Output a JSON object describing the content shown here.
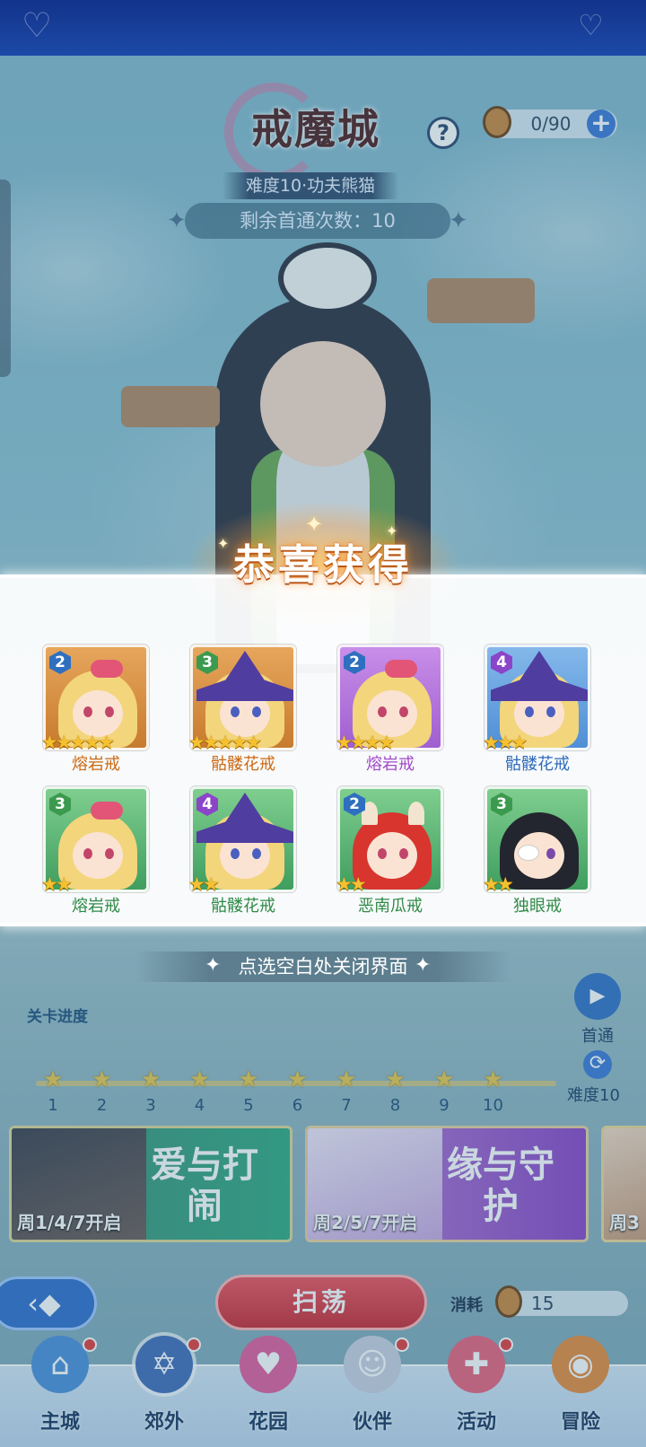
{
  "stage": {
    "title": "戒魔城",
    "difficulty_label": "难度10·功夫熊猫",
    "first_clear_text": "剩余首通次数：10",
    "help_symbol": "?"
  },
  "stamina": {
    "value": "0/90",
    "plus_symbol": "+"
  },
  "popup": {
    "title": "恭喜获得",
    "close_hint": "点选空白处关闭界面",
    "items": [
      {
        "level": "2",
        "stars": 5,
        "name": "熔岩戒",
        "rarity": "orange"
      },
      {
        "level": "3",
        "stars": 5,
        "name": "骷髅花戒",
        "rarity": "orange"
      },
      {
        "level": "2",
        "stars": 4,
        "name": "熔岩戒",
        "rarity": "purple"
      },
      {
        "level": "4",
        "stars": 3,
        "name": "骷髅花戒",
        "rarity": "blue"
      },
      {
        "level": "3",
        "stars": 2,
        "name": "熔岩戒",
        "rarity": "green"
      },
      {
        "level": "4",
        "stars": 2,
        "name": "骷髅花戒",
        "rarity": "green"
      },
      {
        "level": "2",
        "stars": 2,
        "name": "恶南瓜戒",
        "rarity": "green"
      },
      {
        "level": "3",
        "stars": 2,
        "name": "独眼戒",
        "rarity": "green"
      }
    ]
  },
  "progress": {
    "label": "关卡进度",
    "stages": [
      "1",
      "2",
      "3",
      "4",
      "5",
      "6",
      "7",
      "8",
      "9",
      "10"
    ],
    "refresh_label": "难度10",
    "video_label": "首通"
  },
  "events": [
    {
      "name": "爱与打闹",
      "schedule": "周1/4/7开启"
    },
    {
      "name": "缘与守护",
      "schedule": "周2/5/7开启"
    },
    {
      "name": "",
      "schedule": "周3"
    }
  ],
  "actions": {
    "sweep_label": "扫荡",
    "cost_label": "消耗",
    "cost_value": "15"
  },
  "nav": [
    {
      "label": "主城",
      "icon": "castle-icon",
      "color": "#4a8ed8",
      "dot": true
    },
    {
      "label": "郊外",
      "icon": "hexagram-icon",
      "color": "#3f6bb8",
      "dot": true
    },
    {
      "label": "花园",
      "icon": "heart-icon",
      "color": "#e05a9a",
      "dot": false
    },
    {
      "label": "伙伴",
      "icon": "partner-icon",
      "color": "#c9cfe0",
      "dot": true
    },
    {
      "label": "活动",
      "icon": "gift-icon",
      "color": "#e8607a",
      "dot": true
    },
    {
      "label": "冒险",
      "icon": "adventure-icon",
      "color": "#e58a3a",
      "dot": false
    }
  ],
  "colors": {
    "popup_title_glow": "#ff8c28",
    "sweep_button": "#d9333d",
    "accent_blue": "#3a78d6"
  }
}
